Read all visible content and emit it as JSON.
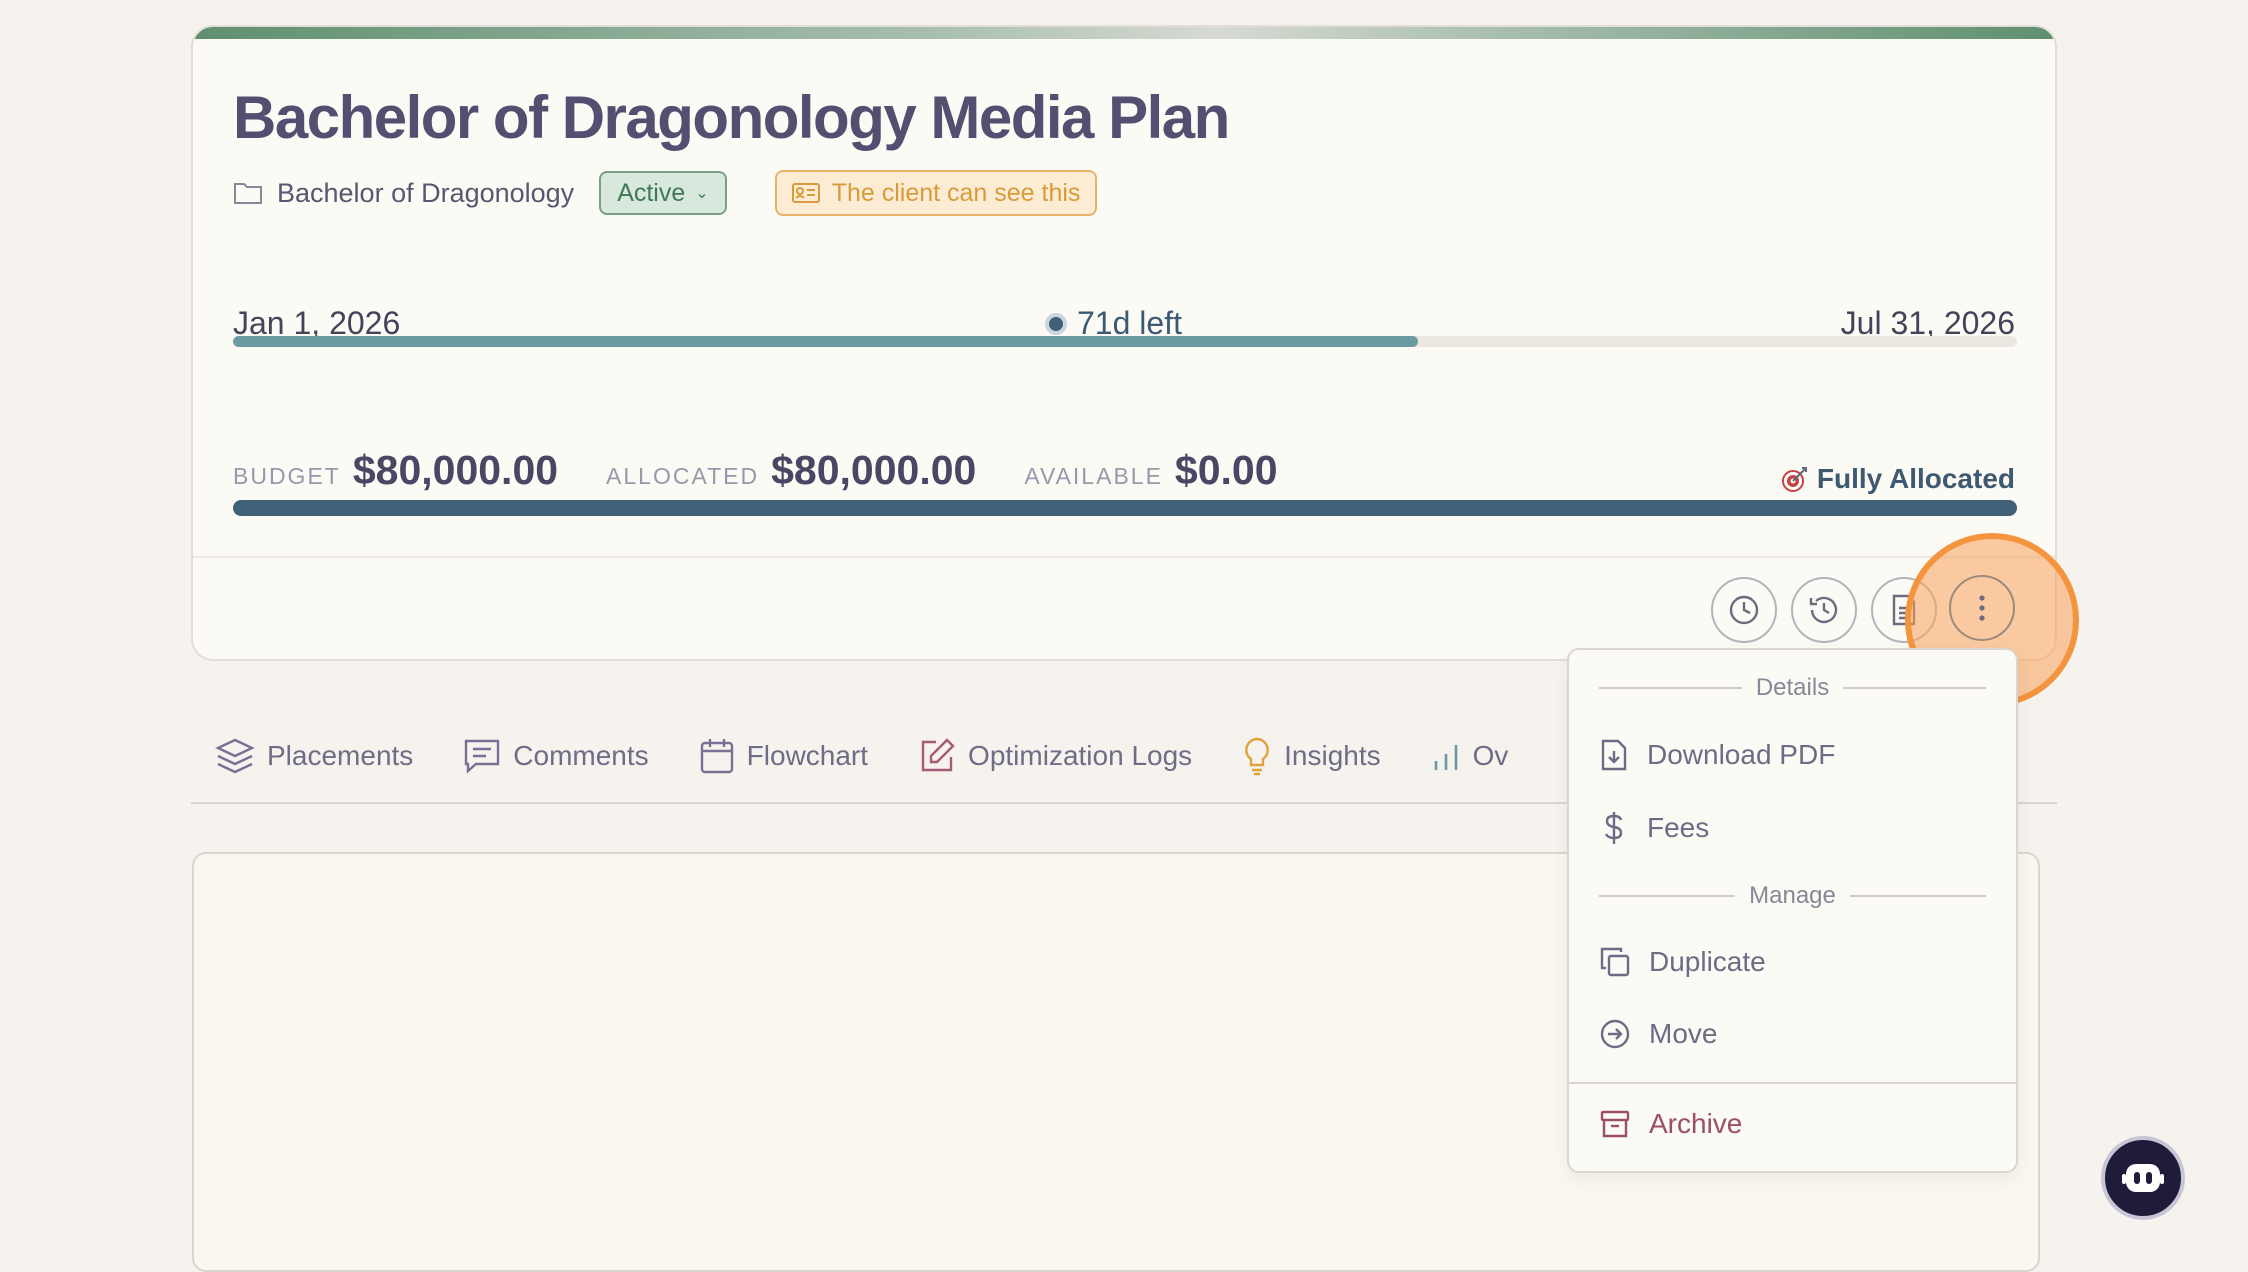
{
  "plan": {
    "title": "Bachelor of Dragonology Media Plan",
    "folder": "Bachelor of Dragonology",
    "status": "Active",
    "visibility": "The client can see this"
  },
  "timeline": {
    "start": "Jan 1, 2026",
    "remaining": "71d left",
    "end": "Jul 31, 2026",
    "progress_fraction": 0.664
  },
  "budget": {
    "budget_label": "BUDGET",
    "budget_value": "$80,000.00",
    "allocated_label": "ALLOCATED",
    "allocated_value": "$80,000.00",
    "available_label": "AVAILABLE",
    "available_value": "$0.00",
    "status": "Fully Allocated",
    "allocated_fraction": 1.0
  },
  "actions": {
    "icons": [
      "clock-icon",
      "history-icon",
      "document-icon",
      "more-vertical-icon"
    ]
  },
  "tabs": [
    {
      "label": "Placements",
      "icon": "layers-icon"
    },
    {
      "label": "Comments",
      "icon": "comment-icon"
    },
    {
      "label": "Flowchart",
      "icon": "calendar-icon"
    },
    {
      "label": "Optimization Logs",
      "icon": "edit-icon"
    },
    {
      "label": "Insights",
      "icon": "lightbulb-icon"
    },
    {
      "label": "Ov",
      "icon": "bar-chart-icon"
    }
  ],
  "menu": {
    "details_header": "Details",
    "download_pdf": "Download PDF",
    "fees": "Fees",
    "manage_header": "Manage",
    "duplicate": "Duplicate",
    "move": "Move",
    "archive": "Archive"
  },
  "colors": {
    "accent_teal": "#3e6178",
    "status_green": "#3f7a55",
    "visibility_orange": "#d89a3a",
    "highlight_orange": "#f5943e",
    "danger": "#9a4f66"
  }
}
